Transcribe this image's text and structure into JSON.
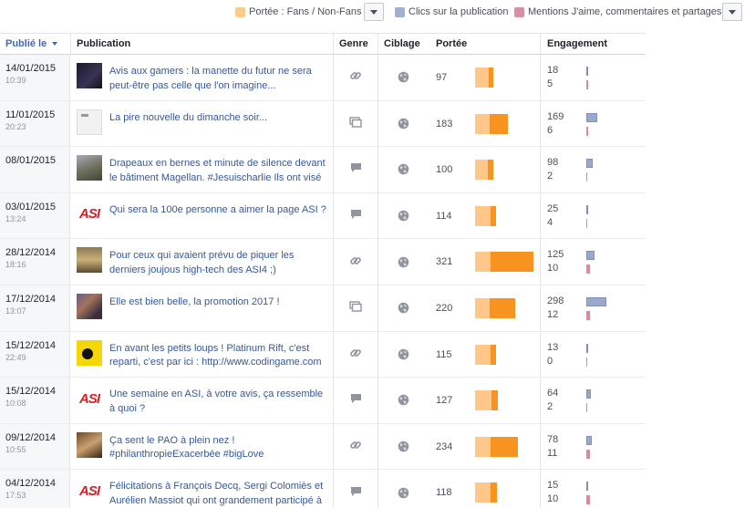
{
  "legend": {
    "items": [
      {
        "label": "Portée : Fans / Non-Fans",
        "color": "#fccd8a"
      },
      {
        "label": "Clics sur la publication",
        "color": "#a3afd0"
      },
      {
        "label": "Mentions J'aime, commentaires et partages",
        "color": "#d68fa6"
      }
    ]
  },
  "columns": {
    "published": "Publié le",
    "publication": "Publication",
    "type": "Genre",
    "targeting": "Ciblage",
    "reach": "Portée",
    "engagement": "Engagement"
  },
  "colors": {
    "reach_fans": "#ffc88a",
    "reach_nonfans": "#f7931e",
    "clicks": "#9aa8cc",
    "reactions": "#d98a9e",
    "link": "#365899"
  },
  "rows": [
    {
      "date": "14/01/2015",
      "time": "10:39",
      "thumb": "dark1",
      "text": "Avis aux gamers : la manette du futur ne sera peut-être pas celle que l'on imagine...",
      "type_icon": "link-icon",
      "reach": "97",
      "fan_frac": 0.75,
      "clicks": "18",
      "reactions": "5"
    },
    {
      "date": "11/01/2015",
      "time": "20:23",
      "thumb": "light1",
      "text": "La pire nouvelle du dimanche soir...",
      "type_icon": "album-icon",
      "reach": "183",
      "fan_frac": 0.45,
      "clicks": "169",
      "reactions": "6"
    },
    {
      "date": "08/01/2015",
      "time": "",
      "thumb": "photo1",
      "text": "Drapeaux en bernes et minute de silence devant le bâtiment Magellan. #Jesuischarlie Ils ont visé",
      "type_icon": "status-icon",
      "reach": "100",
      "fan_frac": 0.7,
      "clicks": "98",
      "reactions": "2"
    },
    {
      "date": "03/01/2015",
      "time": "13:24",
      "thumb": "asi",
      "text": "Qui sera la 100e personne a aimer la page ASI ?",
      "type_icon": "status-icon",
      "reach": "114",
      "fan_frac": 0.72,
      "clicks": "25",
      "reactions": "4"
    },
    {
      "date": "28/12/2014",
      "time": "18:16",
      "thumb": "photo2",
      "text": "Pour ceux qui avaient prévu de piquer les derniers joujous high-tech des ASI4 ;)",
      "type_icon": "link-icon",
      "reach": "321",
      "fan_frac": 0.27,
      "clicks": "125",
      "reactions": "10"
    },
    {
      "date": "17/12/2014",
      "time": "13:07",
      "thumb": "photo3",
      "text": "Elle est bien belle, la promotion 2017 !",
      "type_icon": "album-icon",
      "reach": "220",
      "fan_frac": 0.37,
      "clicks": "298",
      "reactions": "12"
    },
    {
      "date": "15/12/2014",
      "time": "22:49",
      "thumb": "photo4",
      "text": "En avant les petits loups ! Platinum Rift, c'est reparti, c'est par ici : http://www.codingame.com",
      "type_icon": "link-icon",
      "reach": "115",
      "fan_frac": 0.75,
      "clicks": "13",
      "reactions": "0"
    },
    {
      "date": "15/12/2014",
      "time": "10:08",
      "thumb": "asi",
      "text": "Une semaine en ASI, à votre avis, ça ressemble à quoi ?",
      "type_icon": "status-icon",
      "reach": "127",
      "fan_frac": 0.72,
      "clicks": "64",
      "reactions": "2"
    },
    {
      "date": "09/12/2014",
      "time": "10:55",
      "thumb": "photo5",
      "text": "Ça sent le PAO à plein nez ! #philanthropieExacerbée #bigLove",
      "type_icon": "link-icon",
      "reach": "234",
      "fan_frac": 0.37,
      "clicks": "78",
      "reactions": "11"
    },
    {
      "date": "04/12/2014",
      "time": "17:53",
      "thumb": "asi",
      "text": "Félicitations à François Decq, Sergi Colomiès et Aurélien Massiot qui ont grandement participé à",
      "type_icon": "status-icon",
      "reach": "118",
      "fan_frac": 0.72,
      "clicks": "15",
      "reactions": "10"
    }
  ]
}
